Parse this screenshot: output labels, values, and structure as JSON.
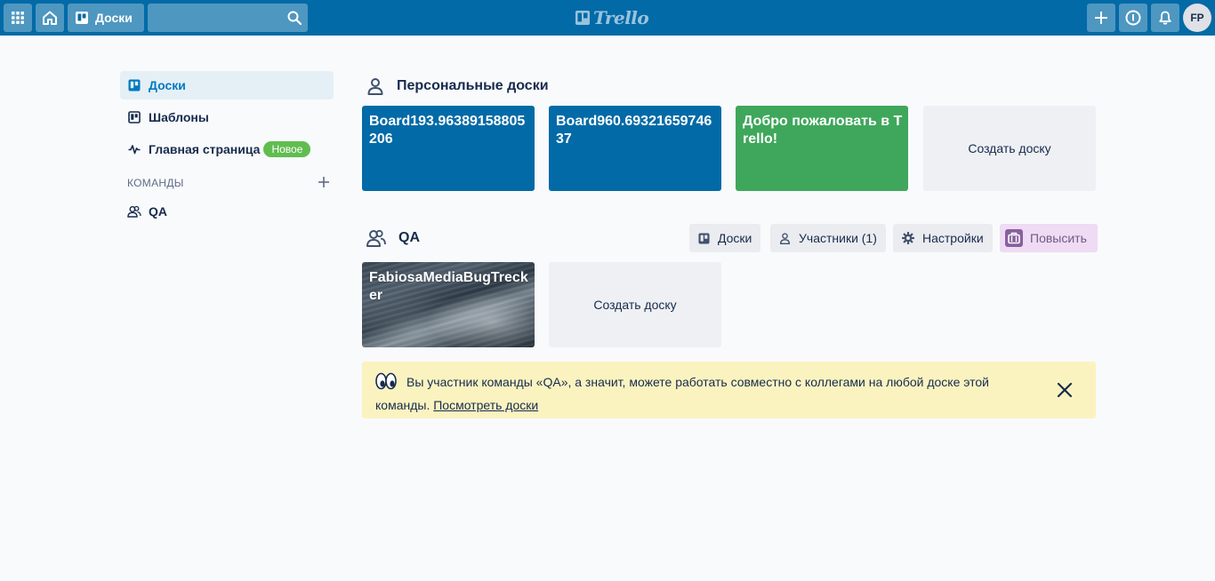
{
  "header": {
    "boards_label": "Доски",
    "search": {
      "value": "",
      "placeholder": ""
    },
    "logo_text": "Trello",
    "avatar_initials": "FP",
    "color": "#026aa7"
  },
  "sidebar": {
    "items": [
      {
        "label": "Доски",
        "icon": "board-icon",
        "active": true
      },
      {
        "label": "Шаблоны",
        "icon": "template-icon"
      },
      {
        "label": "Главная страница",
        "icon": "activity-icon",
        "badge": "Новое"
      }
    ],
    "teams_header": "КОМАНДЫ",
    "teams": [
      {
        "label": "QA",
        "icon": "team-icon"
      }
    ]
  },
  "personal": {
    "title": "Персональные доски",
    "boards": [
      {
        "name": "Board193.96389158805206",
        "color": "#026aa7"
      },
      {
        "name": "Board960.6932165974637",
        "color": "#026aa7"
      },
      {
        "name": "Добро пожаловать в Trello!",
        "color": "#3fa75b"
      }
    ],
    "create_label": "Создать доску"
  },
  "team": {
    "title": "QA",
    "buttons": {
      "boards": "Доски",
      "members": "Участники (1)",
      "settings": "Настройки",
      "upgrade": "Повысить"
    },
    "boards": [
      {
        "name": "FabiosaMediaBugTrecker",
        "background": "photo"
      }
    ],
    "create_label": "Создать доску",
    "notice": {
      "text": "Вы участник команды «QA», а значит, можете работать совместно с коллегами на любой доске этой команды.",
      "link": "Посмотреть доски"
    }
  }
}
